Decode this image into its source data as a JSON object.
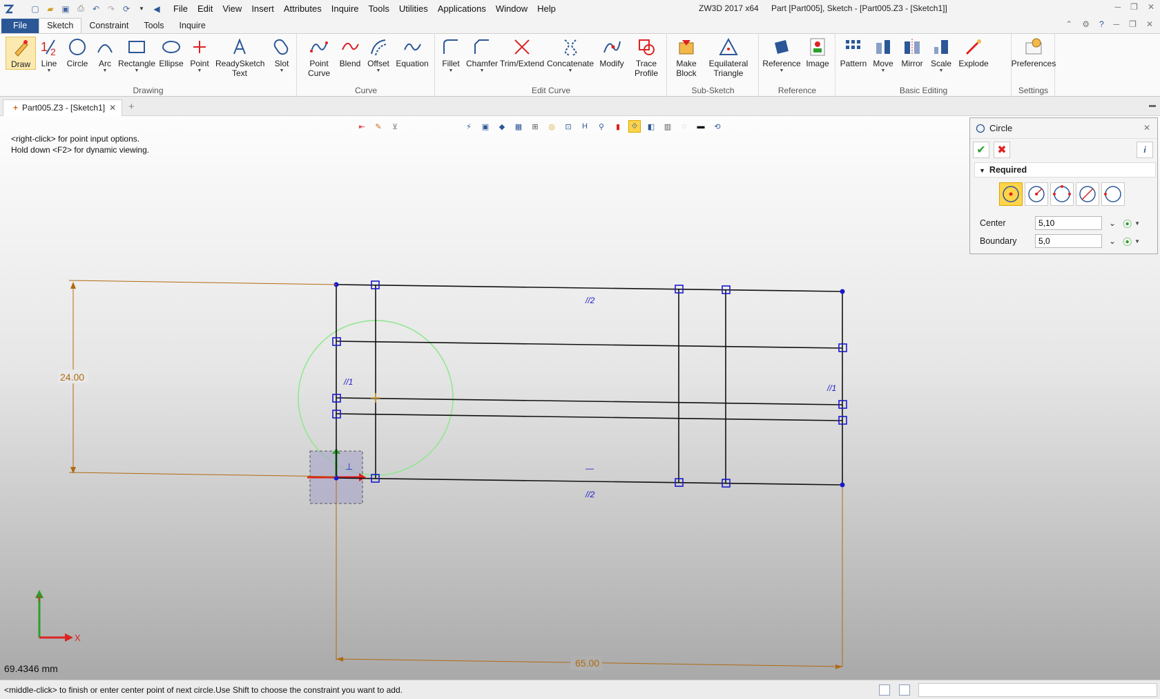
{
  "menubar": {
    "items": [
      "File",
      "Edit",
      "View",
      "Insert",
      "Attributes",
      "Inquire",
      "Tools",
      "Utilities",
      "Applications",
      "Window",
      "Help"
    ],
    "app_title": "ZW3D 2017  x64",
    "doc_title": "Part [Part005],  Sketch - [Part005.Z3 - [Sketch1]]"
  },
  "ribbon_tabs": [
    "File",
    "Sketch",
    "Constraint",
    "Tools",
    "Inquire"
  ],
  "ribbon": {
    "drawing": {
      "label": "Drawing",
      "tools": [
        "Draw",
        "Line",
        "Circle",
        "Arc",
        "Rectangle",
        "Ellipse",
        "Point",
        "ReadySketch Text",
        "Slot"
      ]
    },
    "curve": {
      "label": "Curve",
      "tools": [
        "Point Curve",
        "Blend",
        "Offset",
        "Equation"
      ]
    },
    "edit_curve": {
      "label": "Edit Curve",
      "tools": [
        "Fillet",
        "Chamfer",
        "Trim/Extend",
        "Concatenate",
        "Modify",
        "Trace Profile"
      ]
    },
    "sub_sketch": {
      "label": "Sub-Sketch",
      "tools": [
        "Make Block",
        "Equilateral Triangle"
      ]
    },
    "reference": {
      "label": "Reference",
      "tools": [
        "Reference",
        "Image"
      ]
    },
    "basic_editing": {
      "label": "Basic Editing",
      "tools": [
        "Pattern",
        "Move",
        "Mirror",
        "Scale",
        "Explode"
      ]
    },
    "settings": {
      "label": "Settings",
      "tools": [
        "Preferences"
      ]
    }
  },
  "doc_tab": {
    "label": "Part005.Z3 - [Sketch1]"
  },
  "viewport": {
    "hint1": "<right-click> for point input options.",
    "hint2": "Hold down <F2> for dynamic viewing.",
    "dim_vertical": "24.00",
    "dim_horizontal": "65.00",
    "constraint_par1_left": "//1",
    "constraint_par1_right": "//1",
    "constraint_par2_top": "//2",
    "constraint_par2_bottom": "//2",
    "constraint_perp": "⊥",
    "constraint_horiz": "—",
    "axis_x": "X",
    "axis_y": "Y",
    "readout": "69.4346 mm"
  },
  "circle_panel": {
    "title": "Circle",
    "section": "Required",
    "center_label": "Center",
    "center_value": "5,10",
    "boundary_label": "Boundary",
    "boundary_value": "5,0"
  },
  "statusbar": {
    "message": "<middle-click> to finish or enter center point of next circle.Use Shift to choose the constraint you want to add."
  },
  "colors": {
    "file_tab": "#2b5797",
    "sketch_line": "#111111",
    "constraint_handle": "#1a1acc",
    "dimension": "#b06a12",
    "preview_circle": "#8be88b"
  }
}
